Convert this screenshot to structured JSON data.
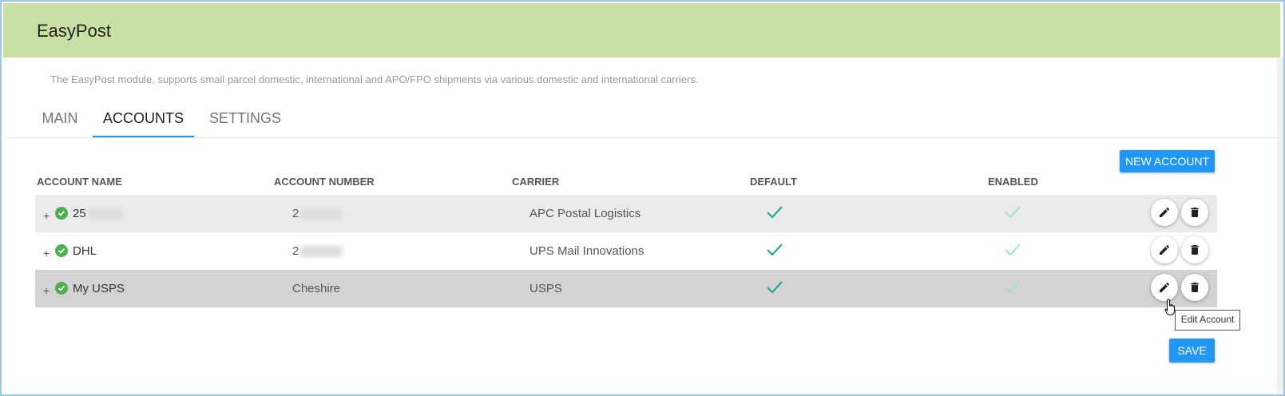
{
  "app": {
    "title": "EasyPost",
    "description": "The EasyPost module, supports small parcel domestic, international and APO/FPO shipments via various domestic and international carriers."
  },
  "tabs": [
    {
      "label": "MAIN",
      "active": false
    },
    {
      "label": "ACCOUNTS",
      "active": true
    },
    {
      "label": "SETTINGS",
      "active": false
    }
  ],
  "buttons": {
    "new_account": "NEW ACCOUNT",
    "save": "SAVE"
  },
  "table": {
    "headers": [
      "ACCOUNT NAME",
      "ACCOUNT NUMBER",
      "CARRIER",
      "DEFAULT",
      "ENABLED"
    ],
    "rows": [
      {
        "expand": "+",
        "name": "25",
        "number": "2",
        "carrier": "APC Postal Logistics",
        "default": true,
        "enabled": true
      },
      {
        "expand": "+",
        "name": "DHL",
        "number": "2",
        "carrier": "UPS Mail Innovations",
        "default": true,
        "enabled": true
      },
      {
        "expand": "+",
        "name": "My USPS",
        "number": "Cheshire",
        "carrier": "USPS",
        "default": true,
        "enabled": true
      }
    ]
  },
  "tooltip": "Edit Account",
  "colors": {
    "header_bg": "#c8e0a3",
    "accent": "#2196f3",
    "row_stripe": "#ebebeb",
    "row_hover": "#d3d3d3",
    "check_dark": "#26a69a",
    "check_light": "#9fded4",
    "status_ok": "#4caf50"
  },
  "icons": [
    "check-circle-icon",
    "check-icon",
    "pencil-icon",
    "trash-icon",
    "pointer-cursor-icon"
  ]
}
